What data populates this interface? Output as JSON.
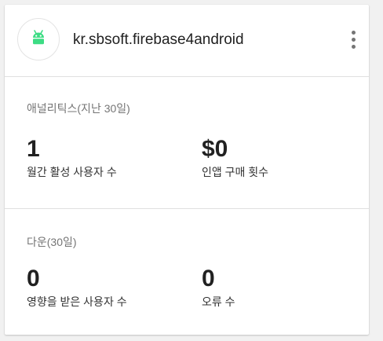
{
  "header": {
    "app_name": "kr.sbsoft.firebase4android",
    "app_icon": "android-icon",
    "menu_icon": "more-vert-icon",
    "accent_color": "#3ddc84"
  },
  "analytics": {
    "title": "애널리틱스(지난 30일)",
    "metrics": [
      {
        "value": "1",
        "label": "월간 활성 사용자 수"
      },
      {
        "value": "$0",
        "label": "인앱 구매 횟수"
      }
    ]
  },
  "downloads": {
    "title": "다운(30일)",
    "metrics": [
      {
        "value": "0",
        "label": "영향을 받은 사용자 수"
      },
      {
        "value": "0",
        "label": "오류 수"
      }
    ]
  }
}
